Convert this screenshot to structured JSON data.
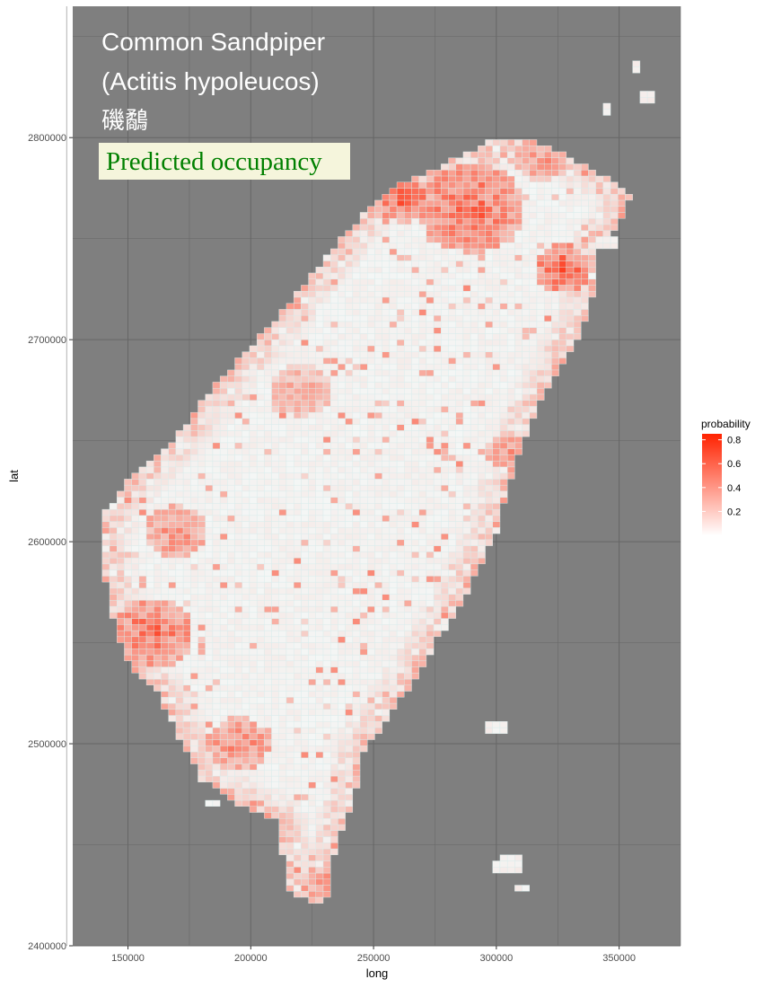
{
  "chart_data": {
    "type": "heatmap",
    "title": "Common Sandpiper",
    "title_line2": "(Actitis hypoleucos)",
    "title_line3": "磯鷸",
    "subtitle": "Predicted occupancy",
    "xlabel": "long",
    "ylabel": "lat",
    "xlim": [
      127500,
      375000
    ],
    "ylim": [
      2400000,
      2865000
    ],
    "x_ticks": [
      150000,
      200000,
      250000,
      300000,
      350000
    ],
    "x_tick_labels": [
      "150000",
      "200000",
      "250000",
      "300000",
      "350000"
    ],
    "y_ticks": [
      2400000,
      2500000,
      2600000,
      2700000,
      2800000
    ],
    "y_tick_labels": [
      "2400000",
      "2500000",
      "2600000",
      "2700000",
      "2800000"
    ],
    "grid": true,
    "legend": {
      "title": "probability",
      "position": "right",
      "range": [
        0.0,
        0.85
      ],
      "ticks": [
        0.2,
        0.4,
        0.6,
        0.8
      ],
      "tick_labels": [
        "0.2",
        "0.4",
        "0.6",
        "0.8"
      ],
      "colors": [
        "#ffffff",
        "#ff2200"
      ]
    },
    "cell_size": 3000,
    "hotspots": [
      {
        "x": 290000,
        "y": 2765000,
        "radius": 22000,
        "value": 0.75
      },
      {
        "x": 262000,
        "y": 2770000,
        "radius": 12000,
        "value": 0.8
      },
      {
        "x": 327000,
        "y": 2735000,
        "radius": 12000,
        "value": 0.8
      },
      {
        "x": 318000,
        "y": 2788000,
        "radius": 10000,
        "value": 0.55
      },
      {
        "x": 160000,
        "y": 2555000,
        "radius": 17000,
        "value": 0.75
      },
      {
        "x": 170000,
        "y": 2605000,
        "radius": 13000,
        "value": 0.6
      },
      {
        "x": 195000,
        "y": 2500000,
        "radius": 13000,
        "value": 0.65
      },
      {
        "x": 230000,
        "y": 2430000,
        "radius": 8000,
        "value": 0.6
      },
      {
        "x": 305000,
        "y": 2645000,
        "radius": 9000,
        "value": 0.55
      },
      {
        "x": 272000,
        "y": 2515000,
        "radius": 8000,
        "value": 0.5
      },
      {
        "x": 220000,
        "y": 2675000,
        "radius": 13000,
        "value": 0.45
      }
    ],
    "islands": [
      {
        "x": 357000,
        "y": 2835000,
        "rx": 3000,
        "ry": 3000
      },
      {
        "x": 361000,
        "y": 2820000,
        "rx": 3000,
        "ry": 2500
      },
      {
        "x": 345000,
        "y": 2813000,
        "rx": 2500,
        "ry": 2500
      },
      {
        "x": 346000,
        "y": 2748000,
        "rx": 2500,
        "ry": 2500
      },
      {
        "x": 300000,
        "y": 2508000,
        "rx": 3500,
        "ry": 3000
      },
      {
        "x": 185000,
        "y": 2471000,
        "rx": 3500,
        "ry": 2500
      },
      {
        "x": 305000,
        "y": 2440000,
        "rx": 6000,
        "ry": 5000
      },
      {
        "x": 310000,
        "y": 2428000,
        "rx": 2500,
        "ry": 2500
      }
    ]
  },
  "colors": {
    "panel_background": "#7f7f7f",
    "grid_line": "#666666",
    "land_low": "#f4fbfb",
    "cell_border": "#d8eeee",
    "subtitle_box_fill": "#f5f5dc",
    "subtitle_text": "#008000"
  }
}
